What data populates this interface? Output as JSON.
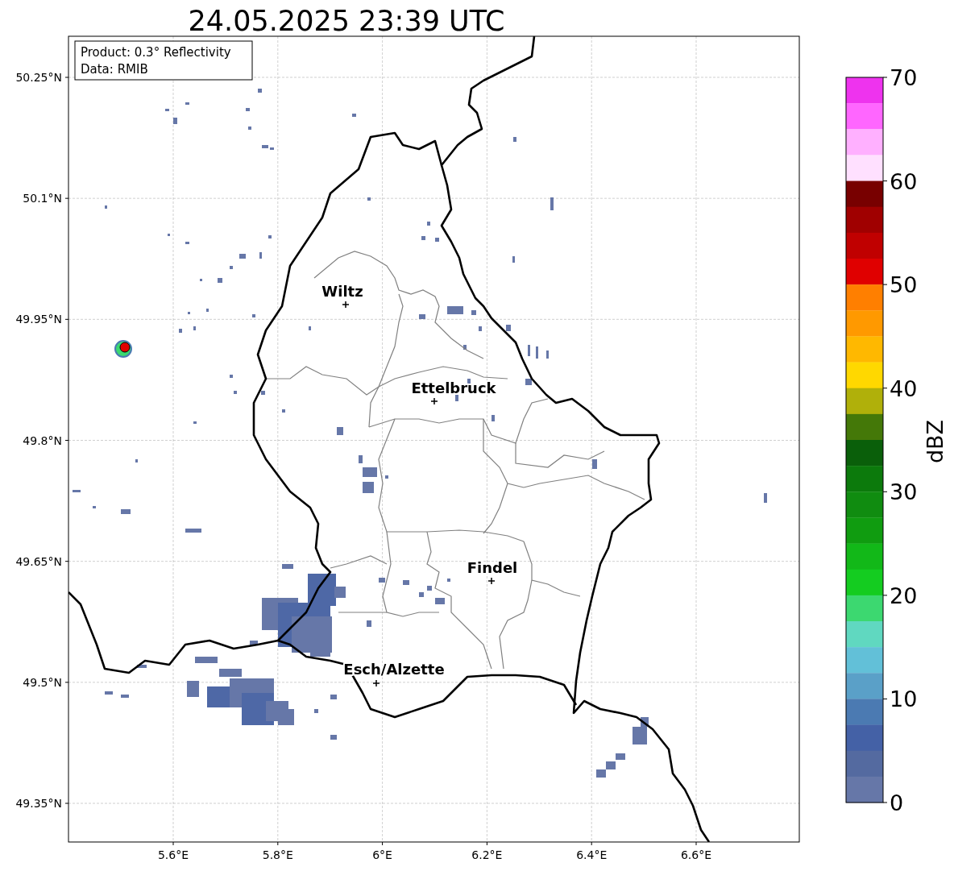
{
  "title": "24.05.2025 23:39 UTC",
  "info_box": [
    "Product: 0.3° Reflectivity",
    "Data: RMIB"
  ],
  "map": {
    "lat_ticks": [
      "50.25°N",
      "50.1°N",
      "49.95°N",
      "49.8°N",
      "49.65°N",
      "49.5°N",
      "49.35°N"
    ],
    "lon_ticks": [
      "5.6°E",
      "5.8°E",
      "6°E",
      "6.2°E",
      "6.4°E",
      "6.6°E"
    ],
    "cities": [
      {
        "name": "Wiltz"
      },
      {
        "name": "Ettelbruck"
      },
      {
        "name": "Findel"
      },
      {
        "name": "Esch/Alzette"
      }
    ]
  },
  "colorbar": {
    "label": "dBZ",
    "ticks": [
      "70",
      "60",
      "50",
      "40",
      "30",
      "20",
      "10",
      "0"
    ],
    "segments": [
      {
        "color": "#ee33ee"
      },
      {
        "color": "#ff66ff"
      },
      {
        "color": "#ffb0ff"
      },
      {
        "color": "#ffe0ff"
      },
      {
        "color": "#780000"
      },
      {
        "color": "#a00000"
      },
      {
        "color": "#c00000"
      },
      {
        "color": "#e00000"
      },
      {
        "color": "#ff7f00"
      },
      {
        "color": "#ff9900"
      },
      {
        "color": "#ffb800"
      },
      {
        "color": "#ffd800"
      },
      {
        "color": "#b0b00a"
      },
      {
        "color": "#447808"
      },
      {
        "color": "#0a5f0a"
      },
      {
        "color": "#0c7a0c"
      },
      {
        "color": "#108c10"
      },
      {
        "color": "#109c10"
      },
      {
        "color": "#12b818"
      },
      {
        "color": "#14cc20"
      },
      {
        "color": "#3cd870"
      },
      {
        "color": "#60d8c0"
      },
      {
        "color": "#62c0d8"
      },
      {
        "color": "#5aa0c8"
      },
      {
        "color": "#4b7ab2"
      },
      {
        "color": "#4461a6"
      },
      {
        "color": "#546aa0"
      },
      {
        "color": "#6677a8"
      }
    ]
  }
}
